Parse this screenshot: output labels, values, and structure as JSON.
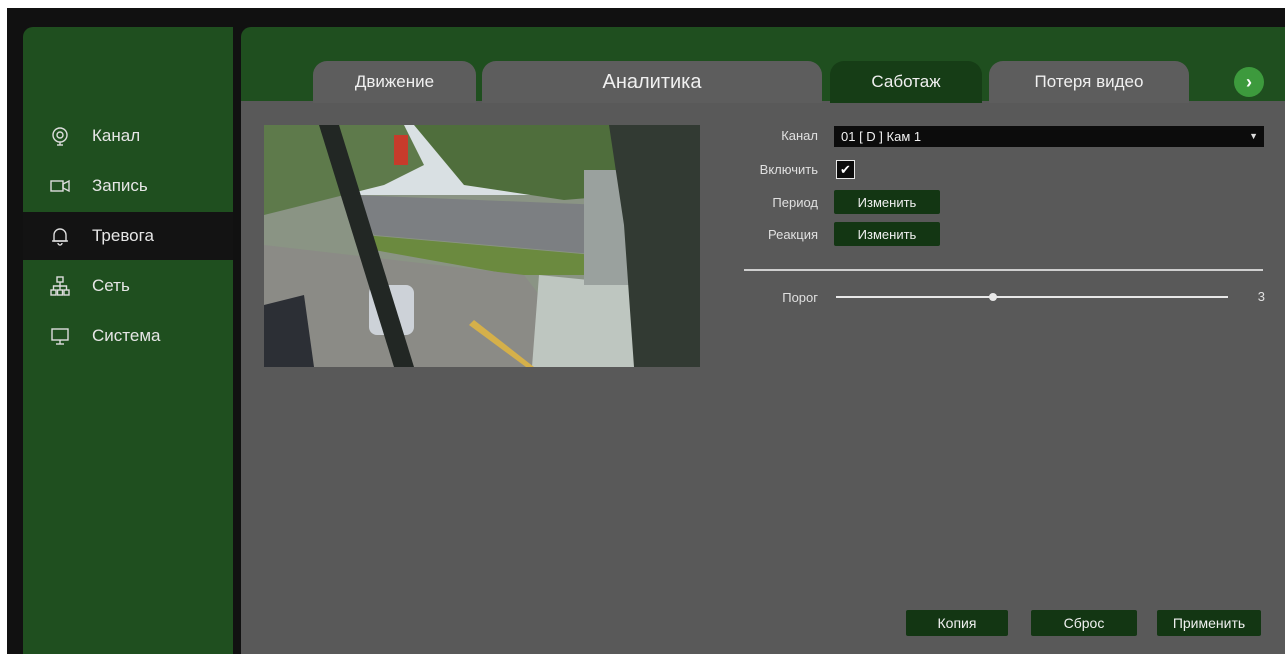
{
  "sidebar": {
    "items": [
      {
        "label": "Канал",
        "icon": "camera-icon"
      },
      {
        "label": "Запись",
        "icon": "record-icon"
      },
      {
        "label": "Тревога",
        "icon": "bell-icon"
      },
      {
        "label": "Сеть",
        "icon": "network-icon"
      },
      {
        "label": "Система",
        "icon": "monitor-icon"
      }
    ],
    "active_index": 2
  },
  "tabs": [
    {
      "label": "Движение"
    },
    {
      "label": "Аналитика"
    },
    {
      "label": "Саботаж"
    },
    {
      "label": "Потеря видео"
    }
  ],
  "active_tab_index": 2,
  "form": {
    "channel_label": "Канал",
    "channel_value": "01 [ D ] Кам 1",
    "enable_label": "Включить",
    "enable_checked": true,
    "period_label": "Период",
    "period_button": "Изменить",
    "reaction_label": "Реакция",
    "reaction_button": "Изменить",
    "threshold_label": "Порог",
    "threshold_value": "3",
    "threshold_fraction": 0.4
  },
  "actions": {
    "copy": "Копия",
    "reset": "Сброс",
    "apply": "Применить"
  },
  "colors": {
    "panel_green": "#1f4f1f",
    "active_tab_green": "#163d16",
    "content_gray": "#595959",
    "accent_green": "#3d9a3d"
  }
}
